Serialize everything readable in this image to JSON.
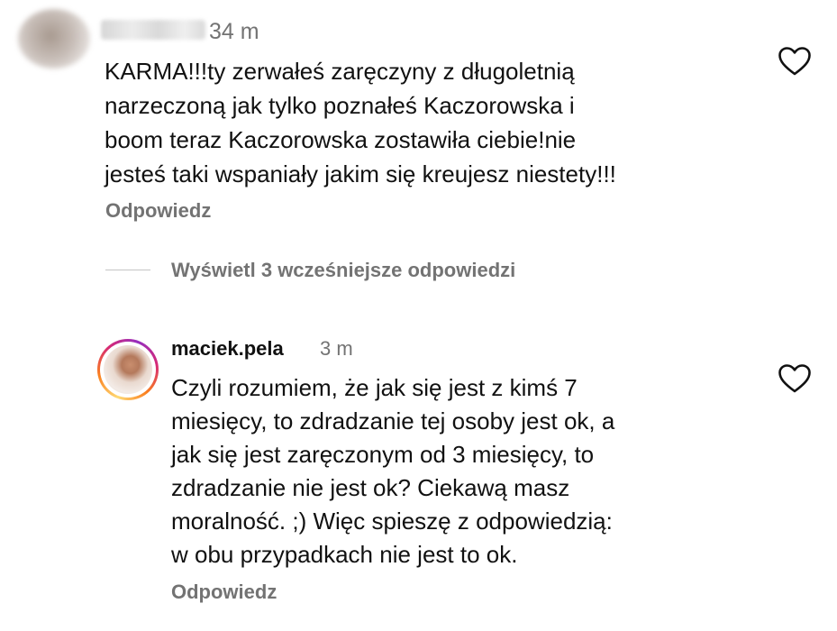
{
  "comment": {
    "time": "34 m",
    "text_lines": [
      "KARMA!!!ty zerwałeś zaręczyny z długoletnią",
      "narzeczoną jak tylko poznałeś Kaczorowska i",
      "boom teraz Kaczorowska zostawiła ciebie!nie",
      "jesteś taki wspaniały jakim się kreujesz niestety!!!"
    ],
    "reply_label": "Odpowiedz",
    "like_icon": "heart-outline-icon"
  },
  "replies_toggle": {
    "label": "Wyświetl 3 wcześniejsze odpowiedzi"
  },
  "reply": {
    "username": "maciek.pela",
    "time": "3 m",
    "text_lines": [
      "Czyli rozumiem, że jak się jest z kimś 7",
      "miesięcy, to zdradzanie tej osoby jest ok, a",
      "jak się jest zaręczonym od 3 miesięcy, to",
      "zdradzanie nie jest ok? Ciekawą masz",
      "moralność. ;) Więc spieszę z odpowiedzią:",
      "w obu przypadkach nie jest to ok."
    ],
    "reply_label": "Odpowiedz",
    "like_icon": "heart-outline-icon"
  },
  "colors": {
    "text": "#111111",
    "secondary_text": "#737373",
    "divider": "#c4c4c4",
    "story_ring": [
      "#feda75",
      "#fa7e1e",
      "#d62976",
      "#962fbf"
    ]
  }
}
